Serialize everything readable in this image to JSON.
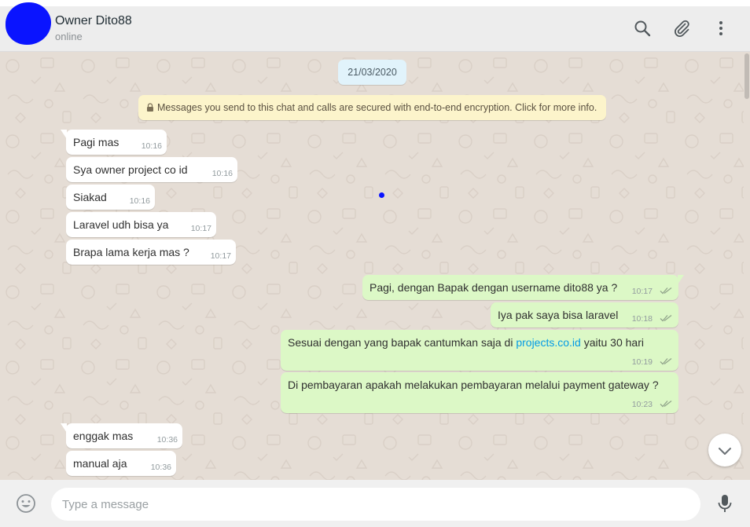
{
  "header": {
    "contact_name": "Owner Dito88",
    "status": "online",
    "icons": [
      "search-icon",
      "attach-icon",
      "menu-icon"
    ]
  },
  "chat": {
    "date_chip": "21/03/2020",
    "encryption_notice": "Messages you send to this chat and calls are secured with end-to-end encryption. Click for more info.",
    "messages": [
      {
        "direction": "in",
        "text": "Pagi mas",
        "time": "10:16"
      },
      {
        "direction": "in",
        "text": "Sya owner project co id",
        "time": "10:16"
      },
      {
        "direction": "in",
        "text": "Siakad",
        "time": "10:16"
      },
      {
        "direction": "in",
        "text": "Laravel udh bisa ya",
        "time": "10:17"
      },
      {
        "direction": "in",
        "text": "Brapa lama kerja mas ?",
        "time": "10:17"
      },
      {
        "direction": "out",
        "text": "Pagi, dengan Bapak dengan username dito88 ya ?",
        "time": "10:17"
      },
      {
        "direction": "out",
        "text": "Iya pak saya bisa laravel",
        "time": "10:18"
      },
      {
        "direction": "out",
        "text_before": "Sesuai dengan yang bapak cantumkan saja di ",
        "link": "projects.co.id",
        "text_after": " yaitu 30 hari",
        "time": "10:19"
      },
      {
        "direction": "out",
        "text": "Di pembayaran apakah melakukan pembayaran melalui payment gateway ?",
        "time": "10:23"
      },
      {
        "direction": "in",
        "text": "enggak mas",
        "time": "10:36"
      },
      {
        "direction": "in",
        "text": "manual aja",
        "time": "10:36"
      }
    ]
  },
  "footer": {
    "input_placeholder": "Type a message",
    "input_value": ""
  },
  "colors": {
    "header_bg": "#ededed",
    "chat_bg": "#e5ddd5",
    "incoming_bubble": "#ffffff",
    "outgoing_bubble": "#dcf8c6",
    "link": "#039be5",
    "date_chip_bg": "#e1f3fb",
    "notice_bg": "#fcf4cb"
  }
}
